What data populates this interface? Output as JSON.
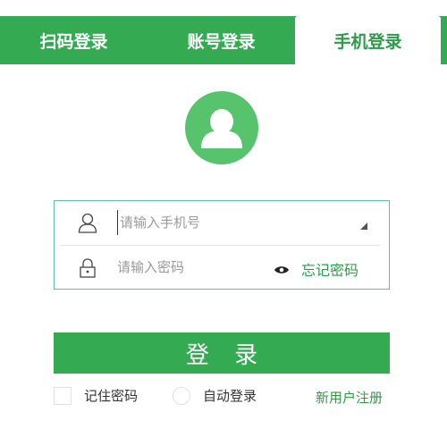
{
  "tabs": [
    {
      "label": "扫码登录",
      "active": false
    },
    {
      "label": "账号登录",
      "active": false
    },
    {
      "label": "手机登录",
      "active": true
    }
  ],
  "form": {
    "phone_placeholder": "请输入手机号",
    "password_placeholder": "请输入密码",
    "forgot_label": "忘记密码"
  },
  "login_button_label": "登 录",
  "options": {
    "remember_label": "记住密码",
    "auto_login_label": "自动登录",
    "register_label": "新用户注册"
  },
  "colors": {
    "brand_green": "#34aa53",
    "link_green": "#2e9a4a",
    "avatar_green": "#57c46d"
  },
  "icons": [
    "user-avatar-icon",
    "user-icon",
    "lock-icon",
    "dropdown-arrow-icon",
    "eye-icon"
  ]
}
